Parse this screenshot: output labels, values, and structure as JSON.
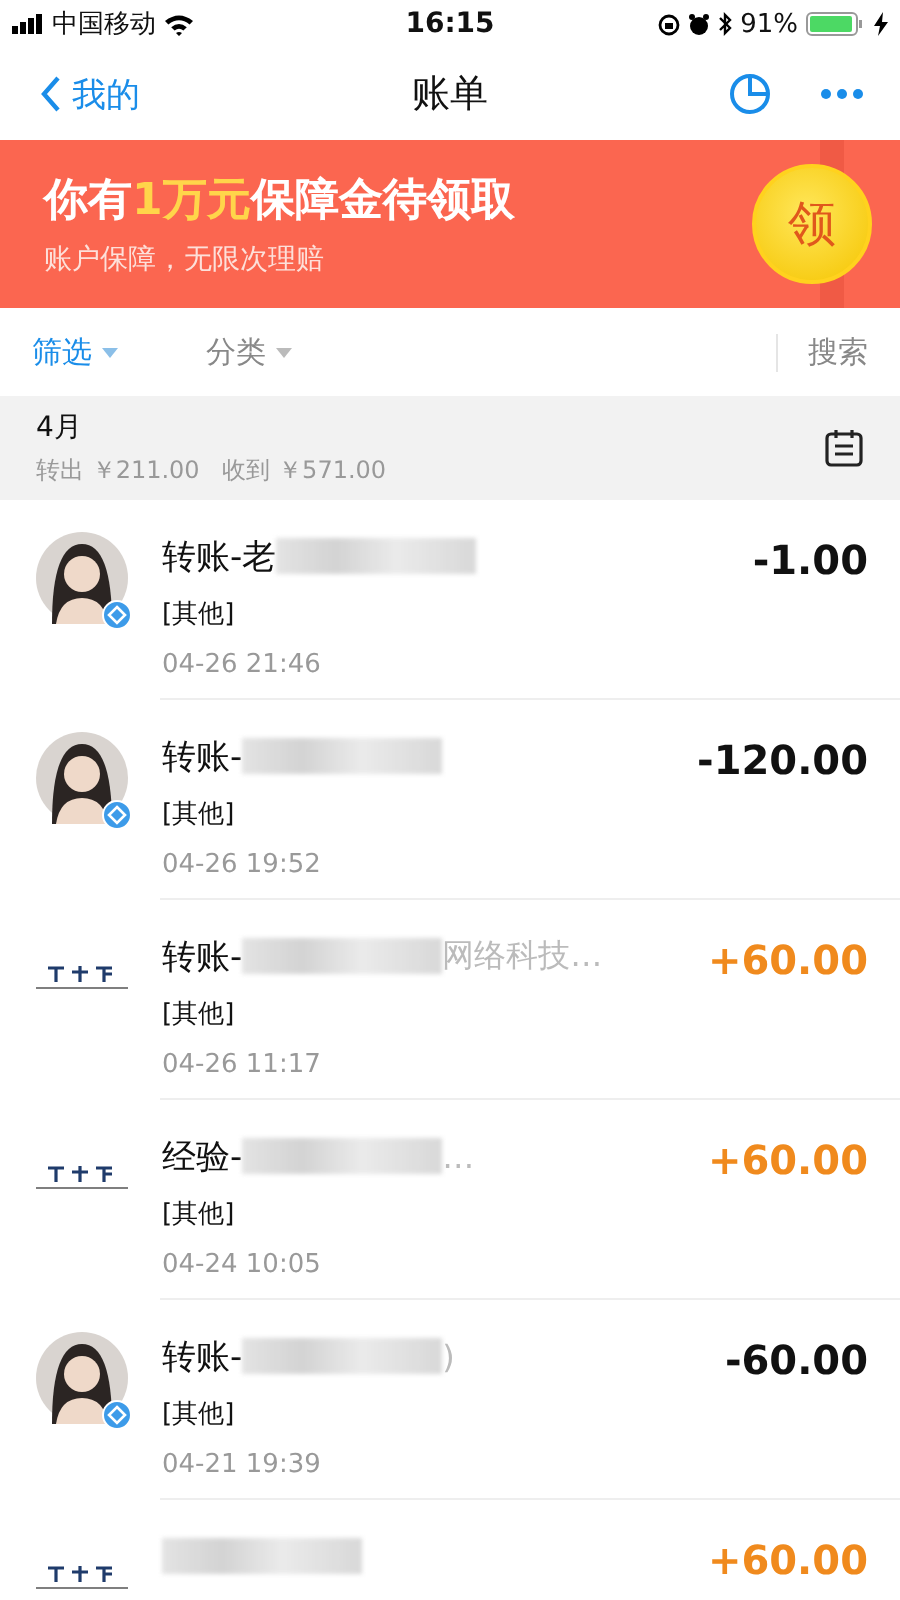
{
  "status_bar": {
    "carrier": "中国移动",
    "time": "16:15",
    "battery": "91%"
  },
  "nav": {
    "back": "我的",
    "title": "账单"
  },
  "banner": {
    "title_before": "你有",
    "title_highlight": "1万元",
    "title_after": "保障金待领取",
    "subtitle": "账户保障，无限次理赔",
    "coin": "领"
  },
  "filters": [
    {
      "label": "筛选",
      "selected": true
    },
    {
      "label": "分类",
      "selected": false
    }
  ],
  "search": "搜索",
  "month": {
    "label": "4月",
    "summary": "转出 ￥211.00   收到 ￥571.00"
  },
  "transactions": [
    {
      "kind": "person",
      "title": "转账-老",
      "redacted": true,
      "category": "[其他]",
      "time": "04-26  21:46",
      "amount": "-1.00",
      "color": "#111111"
    },
    {
      "kind": "person",
      "title": "转账-",
      "redacted": true,
      "category": "[其他]",
      "time": "04-26  19:52",
      "amount": "-120.00",
      "color": "#111111"
    },
    {
      "kind": "logo",
      "title": "转账-",
      "redacted": true,
      "tail": "网络科技…",
      "category": "[其他]",
      "time": "04-26  11:17",
      "amount": "+60.00",
      "color": "#f08a1d"
    },
    {
      "kind": "logo",
      "title": "经验-",
      "redacted": true,
      "tail": "…",
      "category": "[其他]",
      "time": "04-24  10:05",
      "amount": "+60.00",
      "color": "#f08a1d"
    },
    {
      "kind": "person",
      "title": "转账-",
      "redacted": true,
      "tail": ")",
      "category": "[其他]",
      "time": "04-21  19:39",
      "amount": "-60.00",
      "color": "#111111"
    },
    {
      "kind": "logo",
      "redacted": true,
      "amount": "+60.00",
      "color": "#f08a1d"
    }
  ]
}
